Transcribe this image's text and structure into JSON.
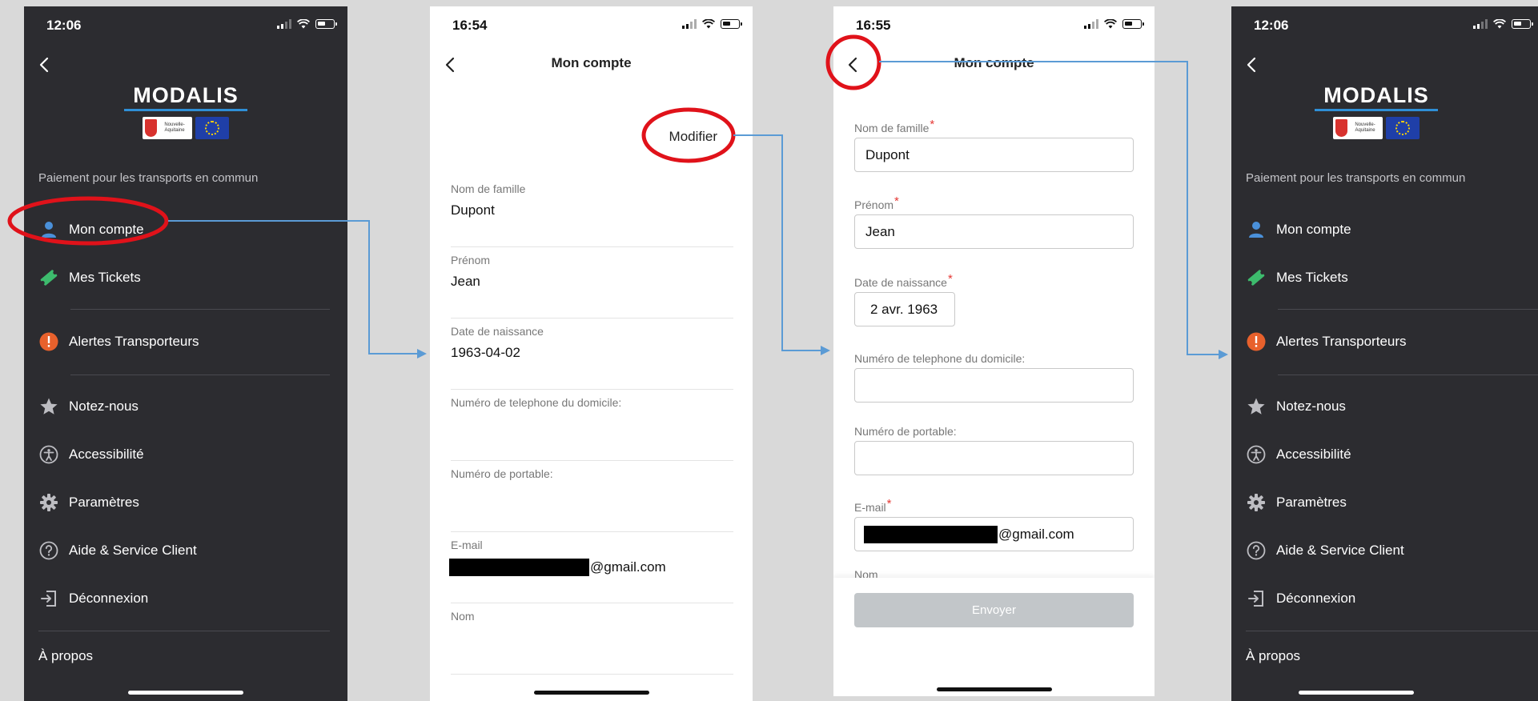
{
  "theme": {
    "drawer_bg": "#2c2c30",
    "accent_blue": "#4a90d9",
    "annotation_red": "#e0121a",
    "arrow_blue": "#5b9bd5",
    "alert_orange": "#e8612c",
    "ticket_green": "#3dbb6d",
    "disabled_button": "#c2c6c9"
  },
  "screen1": {
    "status_time": "12:06",
    "logo_text": "MODALIS",
    "region_badge": "Nouvelle-Aquitaine",
    "caption": "Paiement pour les transports en commun",
    "menu": [
      {
        "label": "Mon compte",
        "icon": "user-icon"
      },
      {
        "label": "Mes Tickets",
        "icon": "ticket-icon"
      },
      {
        "label": "Alertes Transporteurs",
        "icon": "alert-icon"
      },
      {
        "label": "Notez-nous",
        "icon": "star-icon"
      },
      {
        "label": "Accessibilité",
        "icon": "accessibility-icon"
      },
      {
        "label": "Paramètres",
        "icon": "gear-icon"
      },
      {
        "label": "Aide & Service Client",
        "icon": "help-icon"
      },
      {
        "label": "Déconnexion",
        "icon": "logout-icon"
      }
    ],
    "about": "À propos"
  },
  "screen2": {
    "status_time": "16:54",
    "title": "Mon compte",
    "modify": "Modifier",
    "fields": [
      {
        "label": "Nom de famille",
        "value": "Dupont"
      },
      {
        "label": "Prénom",
        "value": "Jean"
      },
      {
        "label": "Date de naissance",
        "value": "1963-04-02"
      },
      {
        "label": "Numéro de telephone du domicile:",
        "value": ""
      },
      {
        "label": "Numéro de portable:",
        "value": ""
      },
      {
        "label": "E-mail",
        "value": "@gmail.com"
      },
      {
        "label": "Nom",
        "value": ""
      }
    ]
  },
  "screen3": {
    "status_time": "16:55",
    "title": "Mon compte",
    "required_mark": "*",
    "fields": [
      {
        "label": "Nom de famille",
        "value": "Dupont",
        "required": true
      },
      {
        "label": "Prénom",
        "value": "Jean",
        "required": true
      },
      {
        "label": "Date de naissance",
        "value": "2 avr. 1963",
        "required": true
      },
      {
        "label": "Numéro de telephone du domicile:",
        "value": "",
        "required": false
      },
      {
        "label": "Numéro de portable:",
        "value": "",
        "required": false
      },
      {
        "label": "E-mail",
        "value": "@gmail.com",
        "required": true
      }
    ],
    "next_label": "Nom",
    "submit": "Envoyer"
  },
  "screen4": {
    "status_time": "12:06",
    "logo_text": "MODALIS",
    "region_badge": "Nouvelle-Aquitaine",
    "caption": "Paiement pour les transports en commun",
    "menu": [
      {
        "label": "Mon compte",
        "icon": "user-icon"
      },
      {
        "label": "Mes Tickets",
        "icon": "ticket-icon"
      },
      {
        "label": "Alertes Transporteurs",
        "icon": "alert-icon"
      },
      {
        "label": "Notez-nous",
        "icon": "star-icon"
      },
      {
        "label": "Accessibilité",
        "icon": "accessibility-icon"
      },
      {
        "label": "Paramètres",
        "icon": "gear-icon"
      },
      {
        "label": "Aide & Service Client",
        "icon": "help-icon"
      },
      {
        "label": "Déconnexion",
        "icon": "logout-icon"
      }
    ],
    "about": "À propos"
  }
}
